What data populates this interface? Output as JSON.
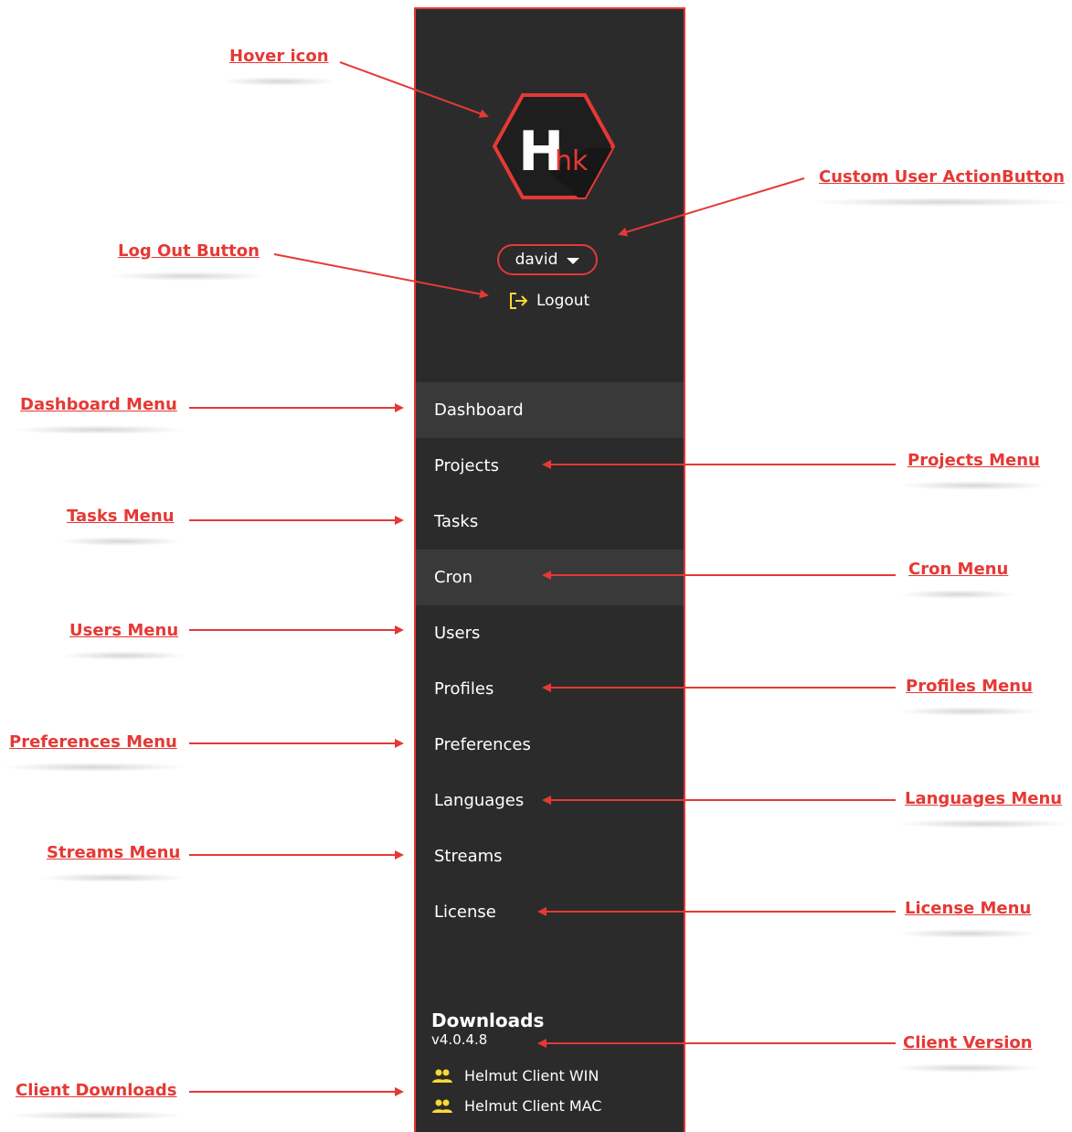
{
  "sidebar": {
    "logo": {
      "letter_big": "H",
      "letters_small": "hk"
    },
    "user_button": {
      "label": "david"
    },
    "logout": {
      "label": "Logout"
    },
    "menu": [
      {
        "label": "Dashboard",
        "highlighted": true
      },
      {
        "label": "Projects",
        "highlighted": false
      },
      {
        "label": "Tasks",
        "highlighted": false
      },
      {
        "label": "Cron",
        "highlighted": true
      },
      {
        "label": "Users",
        "highlighted": false
      },
      {
        "label": "Profiles",
        "highlighted": false
      },
      {
        "label": "Preferences",
        "highlighted": false
      },
      {
        "label": "Languages",
        "highlighted": false
      },
      {
        "label": "Streams",
        "highlighted": false
      },
      {
        "label": "License",
        "highlighted": false
      }
    ],
    "downloads": {
      "title": "Downloads",
      "version": "v4.0.4.8",
      "items": [
        {
          "label": "Helmut Client WIN",
          "icon": "people-icon"
        },
        {
          "label": "Helmut Client MAC",
          "icon": "people-icon"
        }
      ]
    }
  },
  "annotations": {
    "hover_icon": "Hover icon",
    "custom_user_action": "Custom User ActionButton",
    "log_out_button": "Log Out Button",
    "dashboard_menu": "Dashboard Menu",
    "projects_menu": "Projects Menu",
    "tasks_menu": "Tasks Menu",
    "cron_menu": "Cron Menu",
    "users_menu": "Users Menu",
    "profiles_menu": "Profiles Menu",
    "preferences_menu": "Preferences Menu",
    "languages_menu": "Languages Menu",
    "streams_menu": "Streams Menu",
    "license_menu": "License Menu",
    "client_version": "Client Version",
    "client_downloads": "Client Downloads"
  },
  "colors": {
    "accent_red": "#e53935",
    "sidebar_bg": "#2b2b2b",
    "menu_highlight": "#393939",
    "icon_yellow": "#fdd835"
  }
}
